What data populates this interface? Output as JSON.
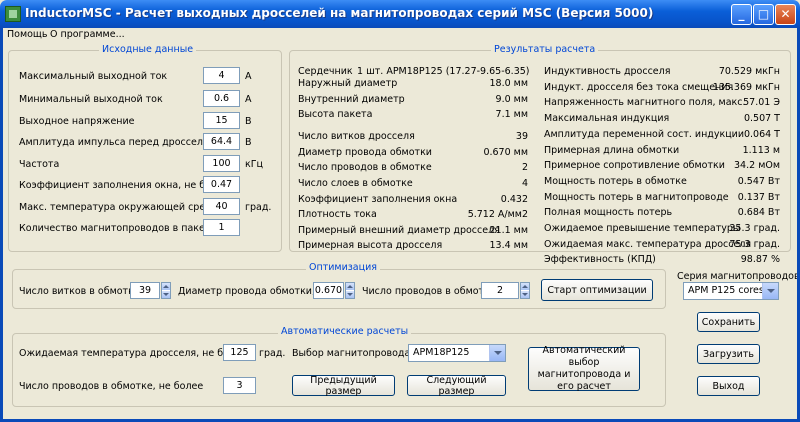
{
  "window": {
    "title": "InductorMSC - Расчет выходных дросселей на магнитопроводах серий MSC (Версия 5000)"
  },
  "menu": {
    "help": "Помощь",
    "about": "О программе..."
  },
  "input": {
    "title": "Исходные данные",
    "rows": [
      {
        "label": "Максимальный выходной ток",
        "value": "4",
        "unit": "А"
      },
      {
        "label": "Минимальный выходной ток",
        "value": "0.6",
        "unit": "А"
      },
      {
        "label": "Выходное напряжение",
        "value": "15",
        "unit": "В"
      },
      {
        "label": "Амплитуда импульса перед дросселем",
        "value": "64.4",
        "unit": "В"
      },
      {
        "label": "Частота",
        "value": "100",
        "unit": "кГц"
      },
      {
        "label": "Коэффициент заполнения окна, не более",
        "value": "0.47",
        "unit": ""
      },
      {
        "label": "Макс. температура окружающей среды",
        "value": "40",
        "unit": "град."
      },
      {
        "label": "Количество магнитопроводов  в пакете",
        "value": "1",
        "unit": ""
      }
    ]
  },
  "results": {
    "title": "Результаты расчета",
    "core_label": "Сердечник",
    "core_value": "1 шт. APM18P125 (17.27-9.65-6.35)",
    "left": [
      {
        "label": "Наружный диаметр",
        "value": "18.0 мм"
      },
      {
        "label": "Внутренний диаметр",
        "value": "9.0 мм"
      },
      {
        "label": "Высота пакета",
        "value": "7.1 мм"
      },
      {
        "label": "Число витков дросселя",
        "value": "39"
      },
      {
        "label": "Диаметр провода обмотки",
        "value": "0.670 мм"
      },
      {
        "label": "Число проводов в обмотке",
        "value": "2"
      },
      {
        "label": "Число слоев в обмотке",
        "value": "4"
      },
      {
        "label": "Коэффициент заполнения окна",
        "value": "0.432"
      },
      {
        "label": "Плотность тока",
        "value": "5.712 А/мм2"
      },
      {
        "label": "Примерный внешний диаметр дросселя",
        "value": "21.1 мм"
      },
      {
        "label": "Примерная высота дросселя",
        "value": "13.4 мм"
      }
    ],
    "right": [
      {
        "label": "Индуктивность дросселя",
        "value": "70.529 мкГн"
      },
      {
        "label": "Индукт. дросселя без тока смещения",
        "value": "135.369 мкГн"
      },
      {
        "label": "Напряженность магнитного поля, макс.",
        "value": "57.01 Э"
      },
      {
        "label": "Максимальная индукция",
        "value": "0.507 Т"
      },
      {
        "label": "Амплитуда переменной сост. индукции",
        "value": "0.064 Т"
      },
      {
        "label": "Примерная длина обмотки",
        "value": "1.113 м"
      },
      {
        "label": "Примерное сопротивление обмотки",
        "value": "34.2 мОм"
      },
      {
        "label": "Мощность потерь в обмотке",
        "value": "0.547 Вт"
      },
      {
        "label": "Мощность потерь в магнитопроводе",
        "value": "0.137 Вт"
      },
      {
        "label": "Полная мощность потерь",
        "value": "0.684 Вт"
      },
      {
        "label": "Ожидаемое превышение температуры",
        "value": "35.3 град."
      },
      {
        "label": "Ожидаемая макс. температура дросселя",
        "value": "75.3 град."
      },
      {
        "label": "Эффективность (КПД)",
        "value": "98.87 %"
      }
    ]
  },
  "optimization": {
    "title": "Оптимизация",
    "turns_label": "Число витков в обмотке",
    "turns_value": "39",
    "wire_label": "Диаметр провода обмотки, мм",
    "wire_value": "0.670",
    "wires_label": "Число проводов в обмотке",
    "wires_value": "2",
    "start_button": "Старт оптимизации"
  },
  "series": {
    "label": "Серия магнитопроводов:",
    "selected": "APM P125 cores"
  },
  "auto": {
    "title": "Автоматические расчеты",
    "temp_label": "Ожидаемая температура дросселя, не более",
    "temp_value": "125",
    "temp_unit": "град.",
    "wires_label": "Число проводов в обмотке, не более",
    "wires_value": "3",
    "core_label": "Выбор магнитопровода:",
    "core_selected": "APM18P125",
    "prev_button": "Предыдущий размер",
    "next_button": "Следующий размер",
    "auto_button": "Автоматический выбор магнитопровода и его расчет"
  },
  "buttons": {
    "save": "Сохранить",
    "load": "Загрузить",
    "exit": "Выход"
  },
  "colors": {
    "titlebar": "#0a5fd8",
    "group_label": "#0046d5",
    "background": "#ece9d8"
  }
}
